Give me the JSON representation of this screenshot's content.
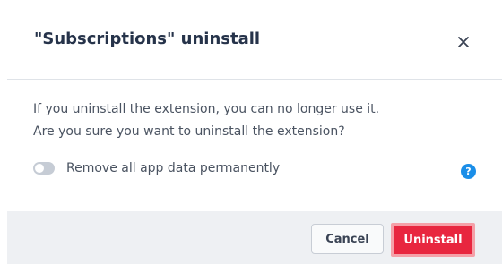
{
  "dialog": {
    "title": "\"Subscriptions\" uninstall",
    "close_icon": "close-icon",
    "message_line1": "If you uninstall the extension, you can no longer use it.",
    "message_line2": "Are you sure you want to uninstall the extension?",
    "toggle": {
      "label": "Remove all app data permanently",
      "checked": false
    },
    "help_icon": "question-circle-icon",
    "help_glyph": "?",
    "buttons": {
      "cancel_label": "Cancel",
      "uninstall_label": "Uninstall"
    }
  },
  "colors": {
    "title": "#26334a",
    "text": "#4a5361",
    "help": "#1a8ee8",
    "danger": "#e8263f",
    "footer_bg": "#eef0f3"
  }
}
